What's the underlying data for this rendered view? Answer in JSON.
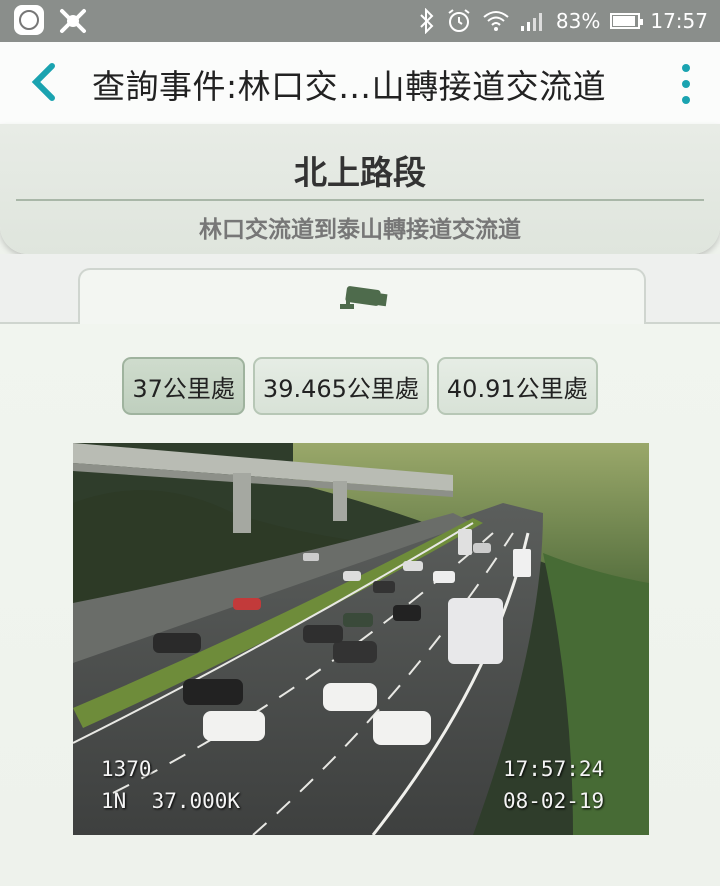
{
  "status_bar": {
    "battery": "83%",
    "battery_level": 0.83,
    "time": "17:57",
    "icons": [
      "app-icon",
      "warning-app-icon",
      "bluetooth-icon",
      "alarm-icon",
      "wifi-icon",
      "signal-icon",
      "battery-icon"
    ]
  },
  "app_bar": {
    "title": "查詢事件:林口交…山轉接道交流道",
    "accent_color": "#1aa3b0"
  },
  "section": {
    "title": "北上路段",
    "subtitle": "林口交流道到泰山轉接道交流道"
  },
  "tabs": [
    {
      "icon": "camera-icon"
    }
  ],
  "km_buttons": [
    {
      "label": "37公里處",
      "selected": true
    },
    {
      "label": "39.465公里處",
      "selected": false
    },
    {
      "label": "40.91公里處",
      "selected": false
    }
  ],
  "camera": {
    "overlay_id": "1370",
    "overlay_location": "1N  37.000K",
    "overlay_time": "17:57:24",
    "overlay_date": "08-02-19"
  }
}
